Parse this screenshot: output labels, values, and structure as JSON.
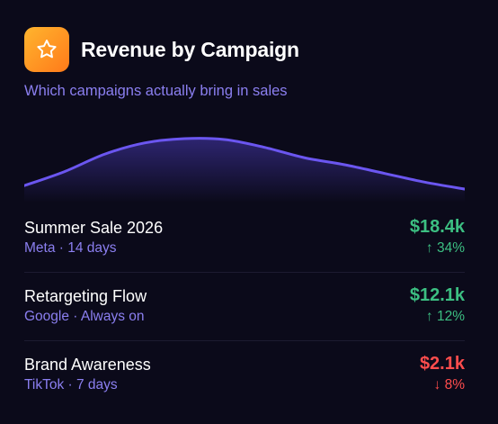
{
  "header": {
    "title": "Revenue by Campaign",
    "subtitle": "Which campaigns actually bring in sales",
    "icon": "star-icon",
    "icon_gradient": [
      "#ffb52e",
      "#ff7a1a"
    ]
  },
  "sparkline": {
    "line_color": "#6b56f0",
    "values": [
      6,
      22,
      42,
      55,
      60,
      59,
      50,
      38,
      30,
      20,
      10,
      2
    ]
  },
  "campaigns": [
    {
      "name": "Summer Sale 2026",
      "meta": "Meta · 14 days",
      "value": "$18.4k",
      "change": "↑ 34%",
      "trend": "up"
    },
    {
      "name": "Retargeting Flow",
      "meta": "Google · Always on",
      "value": "$12.1k",
      "change": "↑ 12%",
      "trend": "up"
    },
    {
      "name": "Brand Awareness",
      "meta": "TikTok · 7 days",
      "value": "$2.1k",
      "change": "↓ 8%",
      "trend": "down"
    }
  ],
  "colors": {
    "background": "#0b0a1a",
    "accent": "#8b7ff0",
    "positive": "#3cbf82",
    "negative": "#ff4d4d"
  }
}
